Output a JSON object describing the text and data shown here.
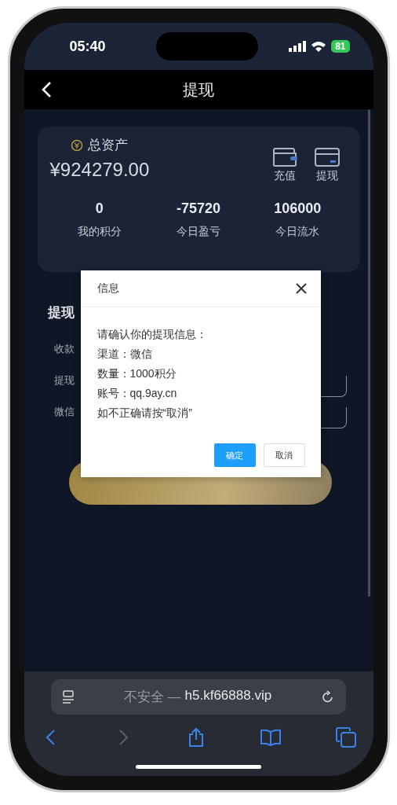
{
  "status_bar": {
    "time": "05:40",
    "battery": "81"
  },
  "nav": {
    "title": "提现"
  },
  "assets_card": {
    "label": "总资产",
    "amount": "¥924279.00",
    "actions": [
      {
        "label": "充值",
        "kind": "wallet"
      },
      {
        "label": "提现",
        "kind": "card"
      }
    ],
    "stats": [
      {
        "value": "0",
        "label": "我的积分"
      },
      {
        "value": "-75720",
        "label": "今日盈亏"
      },
      {
        "value": "106000",
        "label": "今日流水"
      }
    ]
  },
  "form": {
    "heading": "提现",
    "fields": [
      {
        "label": "收款",
        "kind": "select"
      },
      {
        "label": "提现",
        "kind": "input"
      },
      {
        "label": "微信",
        "kind": "input"
      }
    ]
  },
  "dialog": {
    "title": "信息",
    "lines": [
      "请确认你的提现信息：",
      "渠道：微信",
      "数量：1000积分",
      "账号：qq.9ay.cn",
      "如不正确请按“取消”"
    ],
    "buttons": [
      {
        "label": "确定",
        "kind": "primary"
      },
      {
        "label": "取消",
        "kind": "secondary"
      }
    ]
  },
  "browser": {
    "security": "不安全 —",
    "url": "h5.kf66888.vip",
    "toolbar": [
      {
        "kind": "back",
        "disabled": false
      },
      {
        "kind": "forward",
        "disabled": true
      },
      {
        "kind": "share",
        "disabled": false
      },
      {
        "kind": "bookmarks",
        "disabled": false
      },
      {
        "kind": "tabs",
        "disabled": false
      }
    ]
  }
}
